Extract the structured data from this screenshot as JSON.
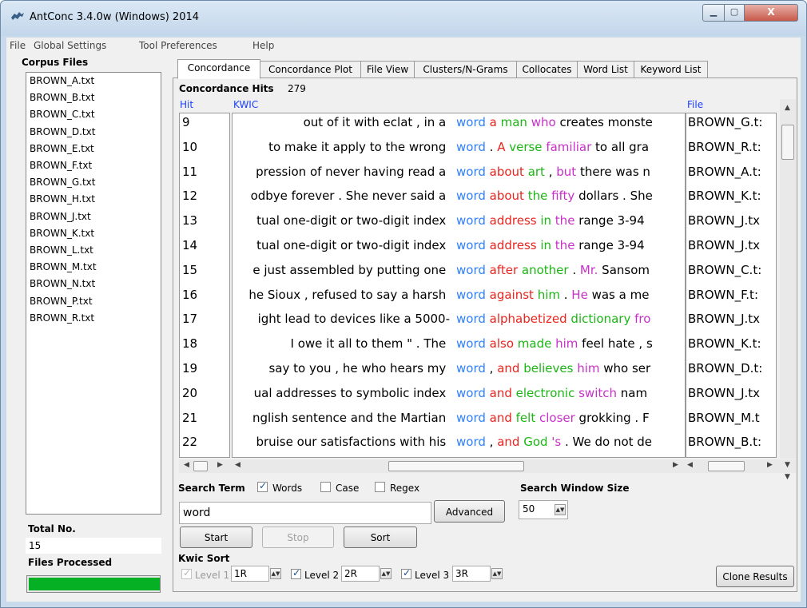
{
  "window": {
    "title": "AntConc 3.4.0w (Windows) 2014"
  },
  "menu": [
    "File",
    "Global Settings",
    "Tool Preferences",
    "Help"
  ],
  "left_panel": {
    "corpus_label": "Corpus Files",
    "files": [
      "BROWN_A.txt",
      "BROWN_B.txt",
      "BROWN_C.txt",
      "BROWN_D.txt",
      "BROWN_E.txt",
      "BROWN_F.txt",
      "BROWN_G.txt",
      "BROWN_H.txt",
      "BROWN_J.txt",
      "BROWN_K.txt",
      "BROWN_L.txt",
      "BROWN_M.txt",
      "BROWN_N.txt",
      "BROWN_P.txt",
      "BROWN_R.txt"
    ],
    "total_label": "Total No.",
    "total_value": "15",
    "files_processed_label": "Files Processed",
    "progress": 1.0,
    "progress_color": "#06b025"
  },
  "tabs": [
    "Concordance",
    "Concordance Plot",
    "File View",
    "Clusters/N-Grams",
    "Collocates",
    "Word List",
    "Keyword List"
  ],
  "active_tab": "Concordance",
  "concordance": {
    "hits_label": "Concordance Hits",
    "hits_count": "279",
    "col_hit": "Hit",
    "col_kwic": "KWIC",
    "col_file": "File",
    "rows": [
      {
        "hit": "9",
        "left": "out of it with eclat , in a ",
        "tokens": [
          [
            "kw",
            "word"
          ],
          [
            "",
            ""
          ],
          [
            "r1",
            " a"
          ],
          [
            "r2",
            " man"
          ],
          [
            "r3",
            " who"
          ],
          [
            "",
            " creates monste"
          ]
        ],
        "file": "BROWN_G.t:"
      },
      {
        "hit": "10",
        "left": "to make it apply to the wrong ",
        "tokens": [
          [
            "kw",
            "word"
          ],
          [
            "",
            " ."
          ],
          [
            "r1",
            " A"
          ],
          [
            "r2",
            " verse"
          ],
          [
            "r3",
            " familiar"
          ],
          [
            "",
            " to all gra"
          ]
        ],
        "file": "BROWN_R.t:"
      },
      {
        "hit": "11",
        "left": "pression of never having read a ",
        "tokens": [
          [
            "kw",
            "word"
          ],
          [
            "r1",
            " about"
          ],
          [
            "r2",
            " art"
          ],
          [
            "",
            " ,"
          ],
          [
            "r3",
            " but"
          ],
          [
            "",
            " there was n"
          ]
        ],
        "file": "BROWN_A.t:"
      },
      {
        "hit": "12",
        "left": "odbye forever . She never said a ",
        "tokens": [
          [
            "kw",
            "word"
          ],
          [
            "r1",
            " about"
          ],
          [
            "r2",
            " the"
          ],
          [
            "r3",
            " fifty"
          ],
          [
            "",
            " dollars . She"
          ]
        ],
        "file": "BROWN_K.t:"
      },
      {
        "hit": "13",
        "left": "tual one-digit or two-digit index ",
        "tokens": [
          [
            "kw",
            "word"
          ],
          [
            "r1",
            " address"
          ],
          [
            "r2",
            " in"
          ],
          [
            "r3",
            " the"
          ],
          [
            "",
            " range 3-94"
          ]
        ],
        "file": "BROWN_J.tx"
      },
      {
        "hit": "14",
        "left": "tual one-digit or two-digit index ",
        "tokens": [
          [
            "kw",
            "word"
          ],
          [
            "r1",
            " address"
          ],
          [
            "r2",
            " in"
          ],
          [
            "r3",
            " the"
          ],
          [
            "",
            " range 3-94"
          ]
        ],
        "file": "BROWN_J.tx"
      },
      {
        "hit": "15",
        "left": "e just assembled by putting one ",
        "tokens": [
          [
            "kw",
            "word"
          ],
          [
            "r1",
            " after"
          ],
          [
            "r2",
            " another"
          ],
          [
            "",
            " ."
          ],
          [
            "r3",
            " Mr."
          ],
          [
            "",
            " Sansom"
          ]
        ],
        "file": "BROWN_C.t:"
      },
      {
        "hit": "16",
        "left": "he Sioux , refused to say a harsh ",
        "tokens": [
          [
            "kw",
            "word"
          ],
          [
            "r1",
            " against"
          ],
          [
            "r2",
            " him"
          ],
          [
            "",
            " ."
          ],
          [
            "r3",
            " He"
          ],
          [
            "",
            " was a me"
          ]
        ],
        "file": "BROWN_F.t:"
      },
      {
        "hit": "17",
        "left": "ight lead to devices like a 5000-",
        "tokens": [
          [
            "kw",
            "word"
          ],
          [
            "r1",
            " alphabetized"
          ],
          [
            "r2",
            " dictionary"
          ],
          [
            "r3",
            " fro"
          ]
        ],
        "file": "BROWN_J.tx"
      },
      {
        "hit": "18",
        "left": "I owe it all to them \" . The ",
        "tokens": [
          [
            "kw",
            "word"
          ],
          [
            "r1",
            " also"
          ],
          [
            "r2",
            " made"
          ],
          [
            "r3",
            " him"
          ],
          [
            "",
            " feel hate , s"
          ]
        ],
        "file": "BROWN_K.t:"
      },
      {
        "hit": "19",
        "left": "say to you , he who hears my ",
        "tokens": [
          [
            "kw",
            "word"
          ],
          [
            "",
            " ,"
          ],
          [
            "r1",
            " and"
          ],
          [
            "r2",
            " believes"
          ],
          [
            "r3",
            " him"
          ],
          [
            "",
            " who ser"
          ]
        ],
        "file": "BROWN_D.t:"
      },
      {
        "hit": "20",
        "left": "ual addresses to symbolic index ",
        "tokens": [
          [
            "kw",
            "word"
          ],
          [
            "r1",
            " and"
          ],
          [
            "r2",
            " electronic"
          ],
          [
            "r3",
            " switch"
          ],
          [
            "",
            " nam"
          ]
        ],
        "file": "BROWN_J.tx"
      },
      {
        "hit": "21",
        "left": "nglish sentence and the Martian ",
        "tokens": [
          [
            "kw",
            "word"
          ],
          [
            "r1",
            " and"
          ],
          [
            "r2",
            " felt"
          ],
          [
            "r3",
            " closer"
          ],
          [
            "",
            " grokking . F"
          ]
        ],
        "file": "BROWN_M.t"
      },
      {
        "hit": "22",
        "left": "bruise our satisfactions with his ",
        "tokens": [
          [
            "kw",
            "word"
          ],
          [
            "",
            " ,"
          ],
          [
            "r1",
            " and"
          ],
          [
            "r2",
            " God"
          ],
          [
            "r3",
            " 's"
          ],
          [
            "",
            " . We do not de"
          ]
        ],
        "file": "BROWN_B.t:"
      }
    ]
  },
  "search": {
    "label": "Search Term",
    "words_label": "Words",
    "words_checked": true,
    "case_label": "Case",
    "case_checked": false,
    "regex_label": "Regex",
    "regex_checked": false,
    "value": "word",
    "advanced_label": "Advanced",
    "window_size_label": "Search Window Size",
    "window_size": "50",
    "start_label": "Start",
    "stop_label": "Stop",
    "sort_label": "Sort"
  },
  "kwic_sort": {
    "label": "Kwic Sort",
    "levels": [
      {
        "label": "Level 1",
        "value": "1R",
        "checked": true,
        "disabled": true
      },
      {
        "label": "Level 2",
        "value": "2R",
        "checked": true,
        "disabled": false
      },
      {
        "label": "Level 3",
        "value": "3R",
        "checked": true,
        "disabled": false
      }
    ],
    "clone_label": "Clone Results"
  },
  "icons": {
    "app": "ant-icon",
    "minimize": "minimize-icon",
    "maximize": "maximize-icon",
    "close": "close-icon"
  }
}
